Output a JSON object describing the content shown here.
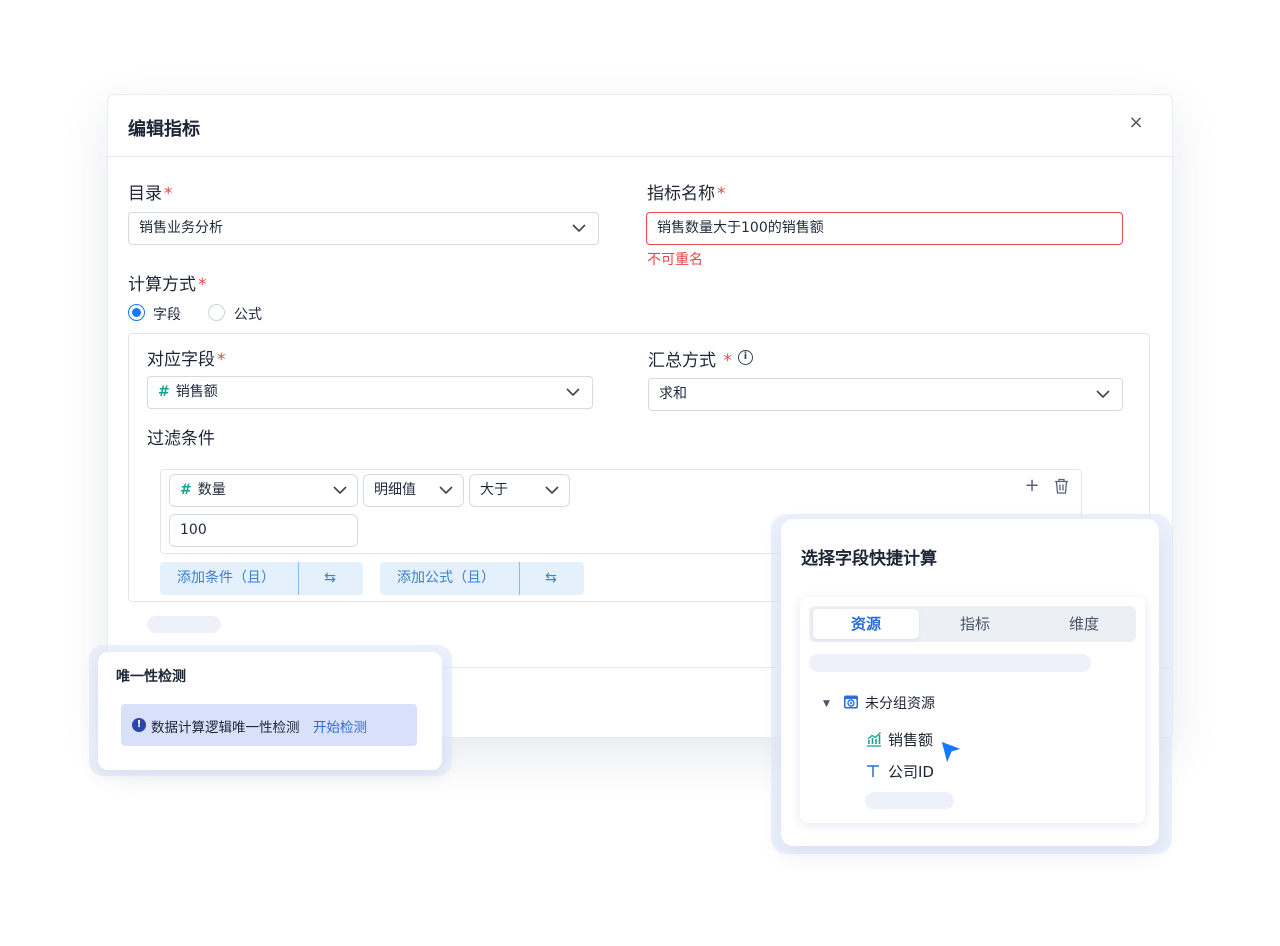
{
  "dialog": {
    "title": "编辑指标",
    "close_glyph": "×"
  },
  "form": {
    "catalog_label": "目录",
    "catalog_value": "销售业务分析",
    "name_label": "指标名称",
    "name_value": "销售数量大于100的销售额",
    "name_error": "不可重名",
    "calc_label": "计算方式",
    "calc_options": [
      "字段",
      "公式"
    ],
    "calc_selected": "字段",
    "required_mark": "*"
  },
  "field_section": {
    "field_label": "对应字段",
    "field_value": "销售额",
    "agg_label": "汇总方式",
    "agg_value": "求和",
    "filter_label": "过滤条件",
    "hash_glyph": "#",
    "info_glyph": "i"
  },
  "condition": {
    "field": "数量",
    "mode": "明细值",
    "operator": "大于",
    "value": "100",
    "add_glyph": "+",
    "delete_glyph": "🗑"
  },
  "buttons": {
    "add_condition": "添加条件（且）",
    "add_formula": "添加公式（且）",
    "swap_glyph": "⇆"
  },
  "uniqueness": {
    "title": "唯一性检测",
    "message": "数据计算逻辑唯一性检测",
    "action": "开始检测",
    "icon_glyph": "!"
  },
  "quick_calc": {
    "title": "选择字段快捷计算",
    "tabs": [
      "资源",
      "指标",
      "维度"
    ],
    "active_tab": "资源",
    "group_label": "未分组资源",
    "items": [
      {
        "label": "销售额",
        "icon": "metric-chart-icon"
      },
      {
        "label": "公司ID",
        "icon": "text-type-icon"
      }
    ]
  },
  "colors": {
    "accent": "#1677ff",
    "error": "#e5484d",
    "link": "#2c6ed5",
    "hash": "#18a38c"
  }
}
